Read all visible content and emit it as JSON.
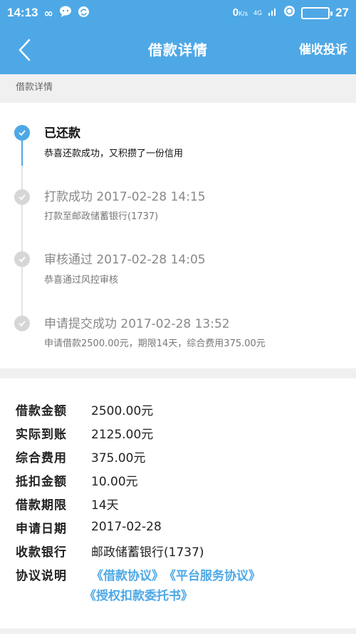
{
  "status_bar": {
    "time": "14:13",
    "icons_left": [
      "infinity-icon",
      "chat-bubble-icon",
      "sync-icon"
    ],
    "speed": "0",
    "speed_unit": "K/s",
    "network": "4G",
    "battery": "27"
  },
  "nav": {
    "title": "借款详情",
    "action": "催收投诉"
  },
  "section_label": "借款详情",
  "timeline": [
    {
      "title": "已还款",
      "desc": "恭喜还款成功，又积攒了一份信用",
      "state": "current"
    },
    {
      "title": "打款成功 2017-02-28 14:15",
      "desc": "打款至邮政储蓄银行(1737)",
      "state": "past"
    },
    {
      "title": "审核通过 2017-02-28 14:05",
      "desc": "恭喜通过风控审核",
      "state": "past"
    },
    {
      "title": "申请提交成功 2017-02-28 13:52",
      "desc": "申请借款2500.00元，期限14天，综合费用375.00元",
      "state": "past"
    }
  ],
  "details": [
    {
      "label": "借款金额",
      "value": "2500.00元"
    },
    {
      "label": "实际到账",
      "value": "2125.00元"
    },
    {
      "label": "综合费用",
      "value": "375.00元"
    },
    {
      "label": "抵扣金额",
      "value": "10.00元"
    },
    {
      "label": "借款期限",
      "value": "14天"
    },
    {
      "label": "申请日期",
      "value": "2017-02-28"
    },
    {
      "label": "收款银行",
      "value": "邮政储蓄银行(1737)"
    }
  ],
  "agreement": {
    "label": "协议说明",
    "links": [
      "《借款协议》",
      "《平台服务协议》",
      "《授权扣款委托书》"
    ]
  },
  "colors": {
    "primary": "#4ea8e6",
    "background": "#f0f0f0",
    "inactive_dot": "#d6d6d6"
  }
}
